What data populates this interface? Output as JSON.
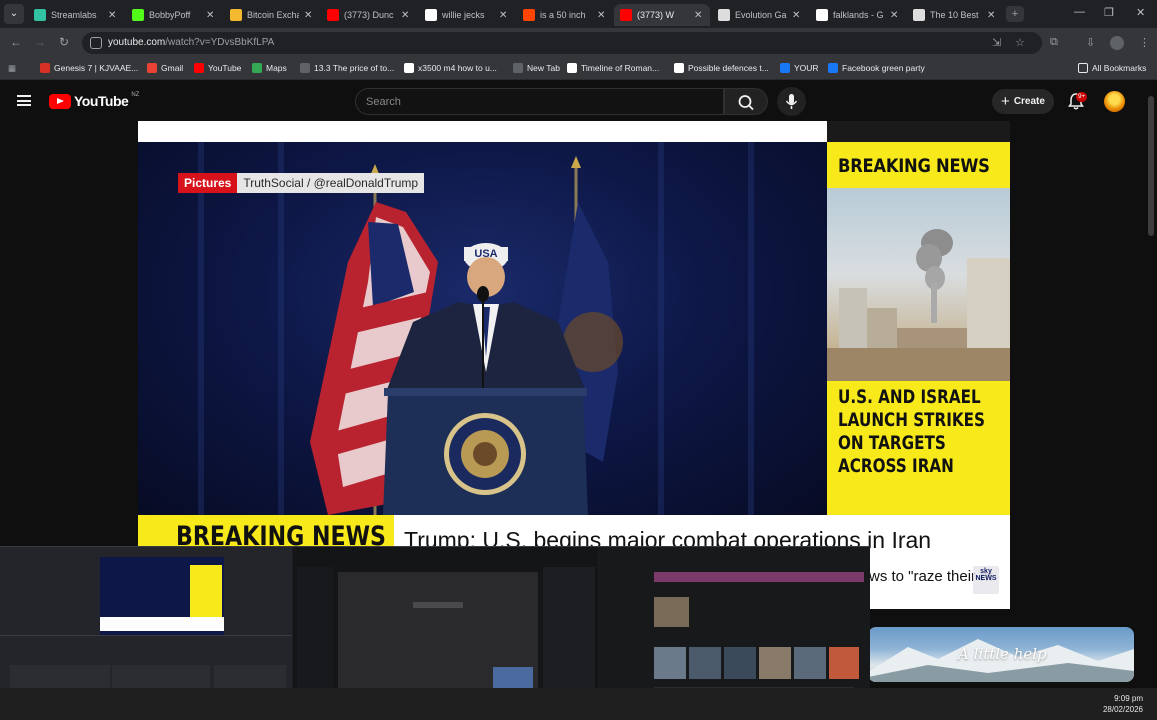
{
  "browser": {
    "tabs": [
      {
        "title": "Streamlabs",
        "favicon_color": "#31c3a2",
        "active": false
      },
      {
        "title": "BobbyPoff",
        "favicon_color": "#53fc18",
        "active": false
      },
      {
        "title": "Bitcoin Exchange",
        "favicon_color": "#f3ba2f",
        "active": false
      },
      {
        "title": "(3773) Dunc",
        "favicon_color": "#ff0000",
        "active": false
      },
      {
        "title": "willie jecks",
        "favicon_color": "#ffffff",
        "active": false
      },
      {
        "title": "is a 50 inch",
        "favicon_color": "#ff4500",
        "active": false
      },
      {
        "title": "(3773) W",
        "favicon_color": "#ff0000",
        "active": true
      },
      {
        "title": "Evolution Ga",
        "favicon_color": "#dddddd",
        "active": false
      },
      {
        "title": "falklands - G",
        "favicon_color": "#ffffff",
        "active": false
      },
      {
        "title": "The 10 Best",
        "favicon_color": "#dddddd",
        "active": false
      }
    ],
    "url_host": "youtube.com",
    "url_path": "/watch?v=YDvsBbKfLPA",
    "bookmarks": [
      {
        "label": "Genesis 7 | KJVAAE...",
        "color": "#d93025"
      },
      {
        "label": "Gmail",
        "color": "#ea4335"
      },
      {
        "label": "YouTube",
        "color": "#ff0000"
      },
      {
        "label": "Maps",
        "color": "#34a853"
      },
      {
        "label": "13.3 The price of to...",
        "color": "#5f6368"
      },
      {
        "label": "x3500 m4 how to u...",
        "color": "#ffffff"
      },
      {
        "label": "New Tab",
        "color": "#5f6368"
      },
      {
        "label": "Timeline of Roman...",
        "color": "#ffffff"
      },
      {
        "label": "Possible defences t...",
        "color": "#ffffff"
      },
      {
        "label": "YOUR",
        "color": "#1877f2"
      },
      {
        "label": "Facebook green party",
        "color": "#1877f2"
      }
    ],
    "all_bookmarks_label": "All Bookmarks"
  },
  "youtube": {
    "logo_text": "YouTube",
    "region": "NZ",
    "search_placeholder": "Search",
    "create_label": "Create",
    "notification_count": "9+"
  },
  "video": {
    "tag_red": "Pictures",
    "tag_grey": "TruthSocial / @realDonaldTrump",
    "side_breaking": "BREAKING NEWS",
    "side_headline": [
      "U.S. AND ISRAEL",
      "LAUNCH STRIKES",
      "ON TARGETS",
      "ACROSS IRAN"
    ],
    "lower_breaking": "BREAKING NEWS",
    "lower_headline": "Trump: U.S. begins major combat operations in Iran",
    "ticker": "ws to \"raze their m",
    "channel_logo": "sky"
  },
  "ad": {
    "script_text": "A little help"
  },
  "taskbar": {
    "time": "9:09 pm",
    "date": "28/02/2026"
  }
}
